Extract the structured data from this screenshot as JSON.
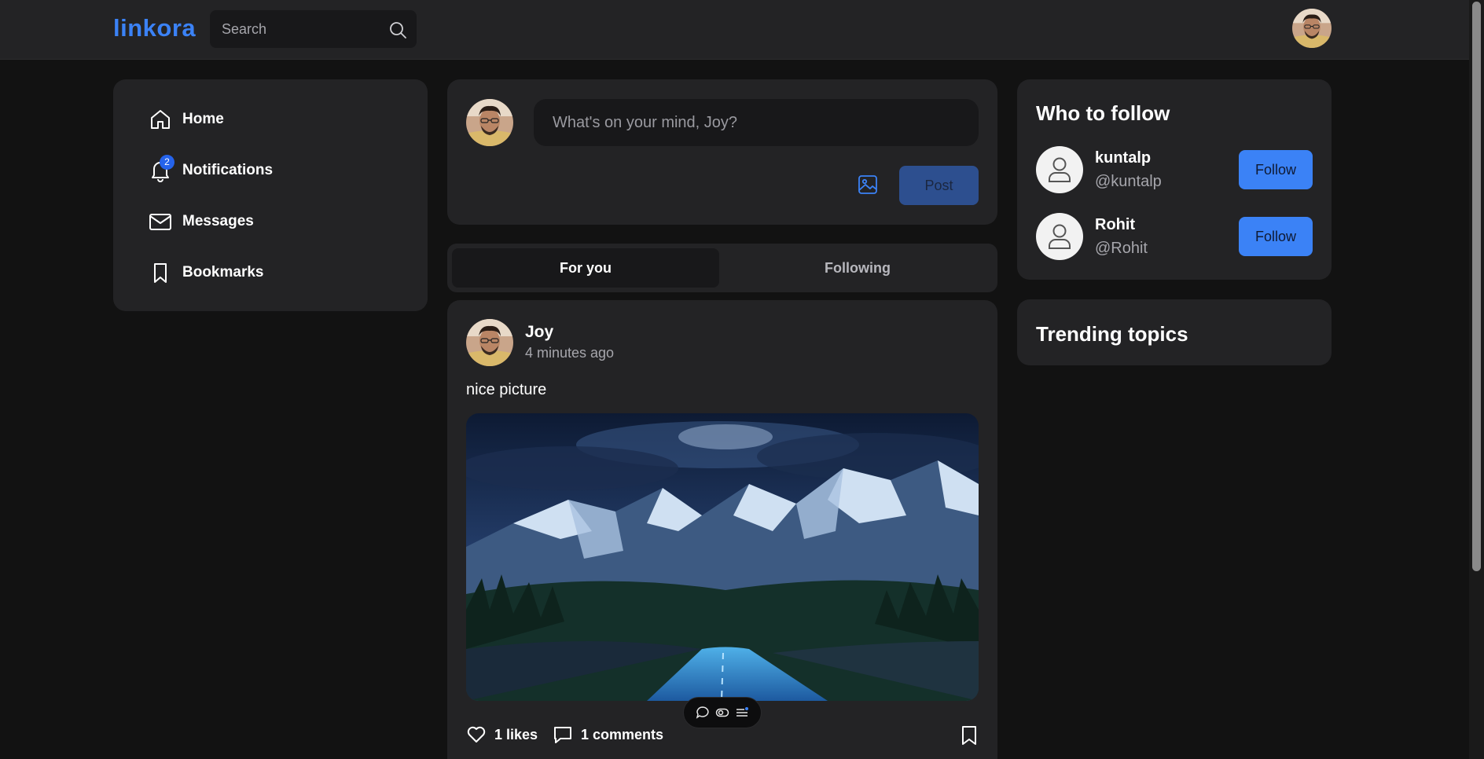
{
  "header": {
    "logo": "linkora",
    "search_placeholder": "Search"
  },
  "nav": {
    "items": [
      {
        "label": "Home",
        "icon": "home-icon"
      },
      {
        "label": "Notifications",
        "icon": "bell-icon",
        "badge": "2"
      },
      {
        "label": "Messages",
        "icon": "mail-icon"
      },
      {
        "label": "Bookmarks",
        "icon": "bookmark-icon"
      }
    ]
  },
  "composer": {
    "placeholder": "What's on your mind, Joy?",
    "post_label": "Post"
  },
  "tabs": [
    {
      "label": "For you",
      "active": true
    },
    {
      "label": "Following",
      "active": false
    }
  ],
  "post": {
    "author": "Joy",
    "time": "4 minutes ago",
    "text": "nice picture",
    "likes_label": "1 likes",
    "comments_label": "1 comments"
  },
  "who_to_follow": {
    "title": "Who to follow",
    "users": [
      {
        "name": "kuntalp",
        "handle": "@kuntalp",
        "button": "Follow"
      },
      {
        "name": "Rohit",
        "handle": "@Rohit",
        "button": "Follow"
      }
    ]
  },
  "trending": {
    "title": "Trending topics"
  },
  "colors": {
    "accent": "#3b82f6",
    "background": "#121212",
    "card": "#232325",
    "input": "#18181a"
  }
}
